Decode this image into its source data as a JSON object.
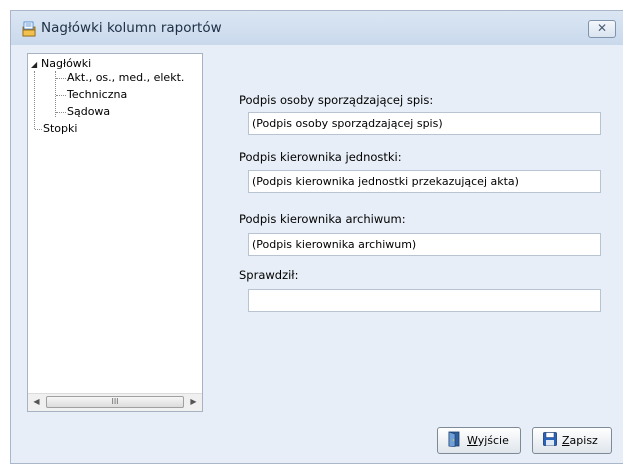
{
  "window": {
    "title": "Nagłówki kolumn raportów"
  },
  "tree": {
    "root": "Nagłówki",
    "children": [
      "Akt., os., med., elekt.",
      "Techniczna",
      "Sądowa"
    ],
    "sibling": "Stopki",
    "scroll_thumb_glyph": "III"
  },
  "fields": [
    {
      "label": "Podpis osoby sporządzającej spis:",
      "value": "(Podpis osoby sporządzającej spis)"
    },
    {
      "label": "Podpis kierownika jednostki:",
      "value": "(Podpis kierownika jednostki przekazującej akta)"
    },
    {
      "label": "Podpis kierownika archiwum:",
      "value": "(Podpis kierownika archiwum)"
    },
    {
      "label": "Sprawdził:",
      "value": ""
    }
  ],
  "buttons": {
    "exit_mnemonic": "W",
    "exit_rest": "yjście",
    "save_mnemonic": "Z",
    "save_rest": "apisz"
  },
  "colors": {
    "accent": "#c9d9ec",
    "window_bg": "#e7eef7",
    "border": "#a9b7c9"
  }
}
